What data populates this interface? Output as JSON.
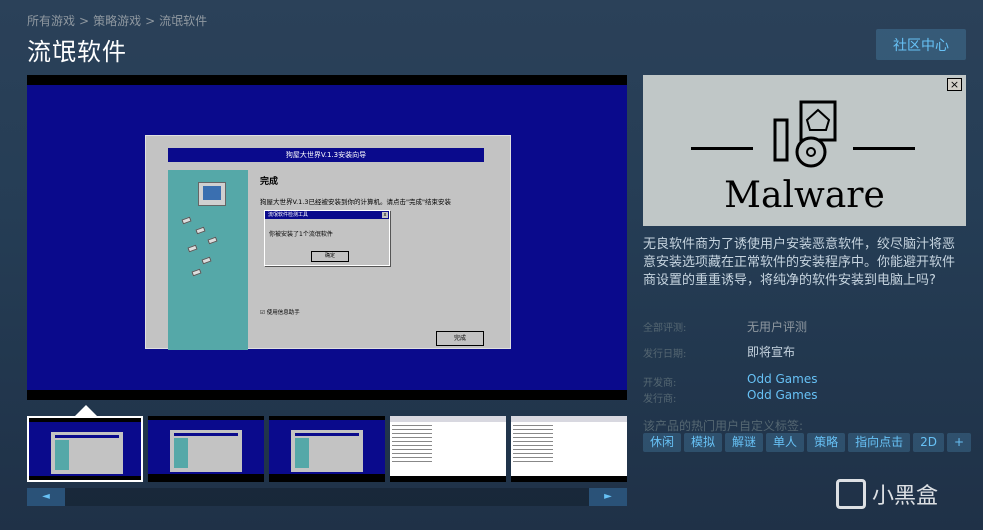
{
  "breadcrumb": [
    "所有游戏",
    "策略游戏",
    "流氓软件"
  ],
  "breadcrumb_sep": ">",
  "title": "流氓软件",
  "community_button": "社区中心",
  "screenshot": {
    "wizard_title": "狗屋大世界V.1.3安装向导",
    "wizard_heading": "完成",
    "wizard_text": "狗屋大世界V.1.3已经被安装到你的计算机。请点击\"完成\"结束安装",
    "dialog_title": "流氓软件检测工具",
    "dialog_message": "你被安装了1个流氓软件",
    "dialog_ok": "确定",
    "checkbox_label": "使用信息助手",
    "finish_button": "完成"
  },
  "scroll": {
    "left": "◄",
    "right": "►"
  },
  "capsule": {
    "close": "×",
    "word": "Malware"
  },
  "description": "无良软件商为了诱使用户安装恶意软件，绞尽脑汁将恶意安装选项藏在正常软件的安装程序中。你能避开软件商设置的重重诱导，将纯净的软件安装到电脑上吗?",
  "meta": {
    "reviews_label": "全部评测:",
    "reviews_value": "无用户评测",
    "release_label": "发行日期:",
    "release_value": "即将宣布",
    "developer_label": "开发商:",
    "developer_value": "Odd Games",
    "publisher_label": "发行商:",
    "publisher_value": "Odd Games"
  },
  "tags_label": "该产品的热门用户自定义标签:",
  "tags": [
    "休闲",
    "模拟",
    "解谜",
    "单人",
    "策略",
    "指向点击",
    "2D",
    "+"
  ],
  "watermark": "小黑盒"
}
